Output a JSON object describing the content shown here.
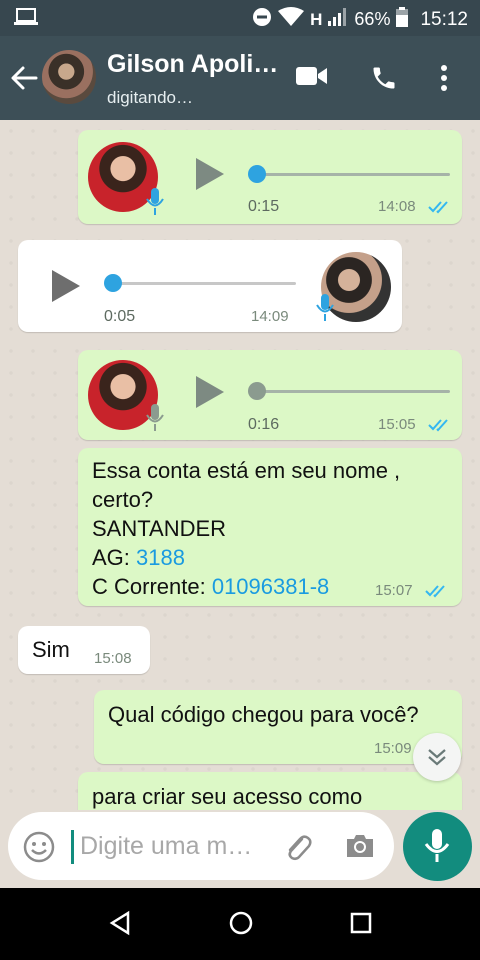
{
  "status_bar": {
    "network": "H",
    "battery": "66%",
    "time": "15:12",
    "icons": [
      "laptop-icon",
      "dnd-icon",
      "wifi-icon",
      "signal-icon",
      "battery-icon"
    ]
  },
  "header": {
    "contact_name": "Gilson Apoli…",
    "status": "digitando…",
    "icons": [
      "back-arrow-icon",
      "video-call-icon",
      "phone-icon",
      "more-vert-icon"
    ]
  },
  "messages": [
    {
      "type": "voice",
      "direction": "outgoing",
      "duration": "0:15",
      "time": "14:08",
      "read": true,
      "progress": 0.0
    },
    {
      "type": "voice",
      "direction": "incoming",
      "duration": "0:05",
      "time": "14:09",
      "progress": 0.0
    },
    {
      "type": "voice",
      "direction": "outgoing",
      "duration": "0:16",
      "time": "15:05",
      "read": true,
      "progress": 0.0
    },
    {
      "type": "text",
      "direction": "outgoing",
      "line1": "Essa conta está em seu nome ,",
      "line2": "certo?",
      "line3": "SANTANDER",
      "ag_label": "AG: ",
      "ag_value": "3188",
      "cc_label": "C Corrente: ",
      "cc_value": "01096381-8",
      "time": "15:07",
      "read": true
    },
    {
      "type": "text",
      "direction": "incoming",
      "text": "Sim",
      "time": "15:08"
    },
    {
      "type": "text",
      "direction": "outgoing",
      "text": "Qual código chegou para você?",
      "time": "15:09",
      "read": true
    },
    {
      "type": "text",
      "direction": "outgoing",
      "text": "para criar seu acesso como",
      "partial": true
    }
  ],
  "input": {
    "placeholder": "Digite uma m…",
    "icons": [
      "emoji-icon",
      "attach-icon",
      "camera-icon",
      "mic-icon"
    ]
  },
  "colors": {
    "header": "#3d4f57",
    "outgoing_bubble": "#dcf8c6",
    "incoming_bubble": "#ffffff",
    "accent": "#128c7e",
    "read_tick": "#34b7f1",
    "link": "#1a9be0"
  }
}
